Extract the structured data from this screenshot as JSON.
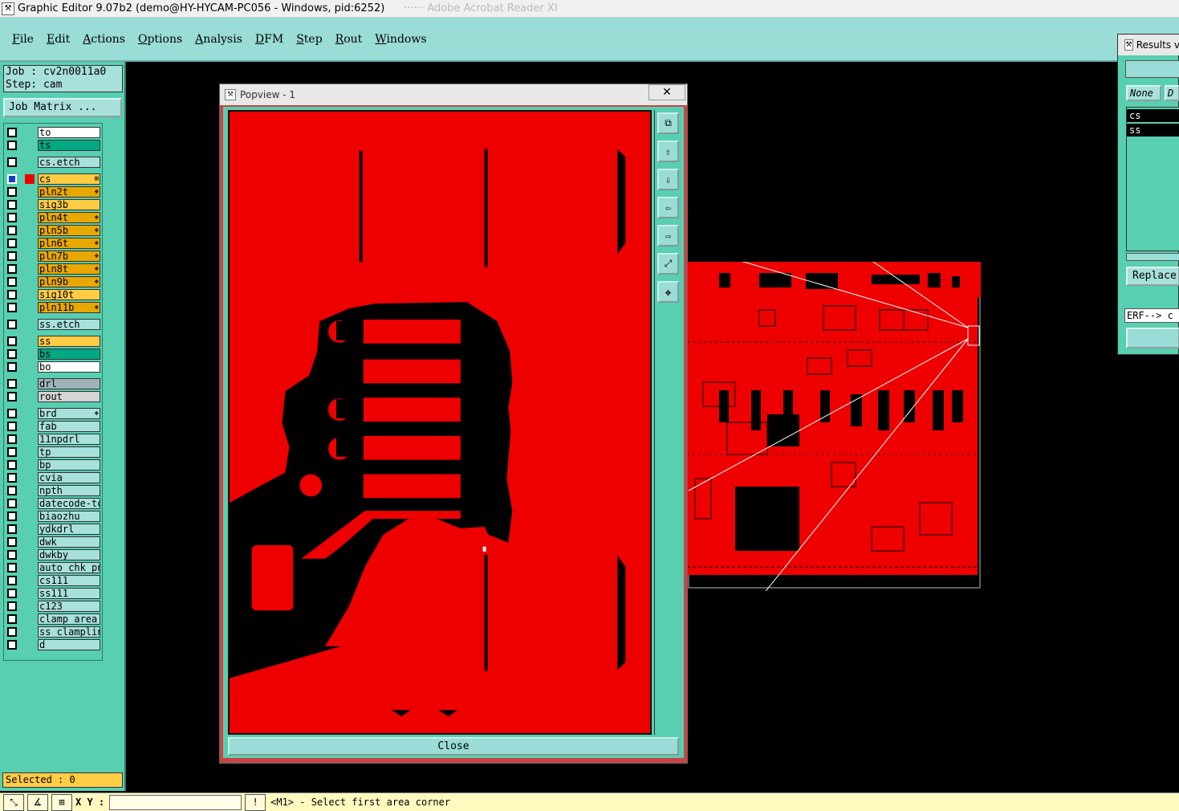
{
  "window": {
    "title": "Graphic Editor 9.07b2 (demo@HY-HYCAM-PC056 - Windows, pid:6252)",
    "ghost_text": "······  Adobe Acrobat Reader XI"
  },
  "menubar": [
    "File",
    "Edit",
    "Actions",
    "Options",
    "Analysis",
    "DFM",
    "Step",
    "Rout",
    "Windows"
  ],
  "job": {
    "job_line": "Job : cv2n0011a0",
    "step_line": "Step: cam",
    "matrix_button": "Job Matrix ..."
  },
  "layers": [
    {
      "name": "to",
      "color": "#ffffff"
    },
    {
      "name": "ts",
      "color": "#00a884"
    },
    {
      "name": "cs.etch",
      "color": "#a8e0dc"
    },
    {
      "name": "cs",
      "color": "#ffcc44",
      "active": true,
      "flag": "⊞"
    },
    {
      "name": "pln2t",
      "color": "#e8a800",
      "flag": "❖"
    },
    {
      "name": "sig3b",
      "color": "#ffcc44"
    },
    {
      "name": "pln4t",
      "color": "#e8a800",
      "flag": "❖"
    },
    {
      "name": "pln5b",
      "color": "#e8a800",
      "flag": "❖"
    },
    {
      "name": "pln6t",
      "color": "#e8a800",
      "flag": "❖"
    },
    {
      "name": "pln7b",
      "color": "#e8a800",
      "flag": "❖"
    },
    {
      "name": "pln8t",
      "color": "#e8a800",
      "flag": "❖"
    },
    {
      "name": "pln9b",
      "color": "#e8a800",
      "flag": "❖"
    },
    {
      "name": "sig10t",
      "color": "#ffcc44"
    },
    {
      "name": "pln11b",
      "color": "#e8a800",
      "flag": "❖"
    },
    {
      "name": "ss.etch",
      "color": "#a8e0dc"
    },
    {
      "name": "ss",
      "color": "#ffcc44"
    },
    {
      "name": "bs",
      "color": "#00a884"
    },
    {
      "name": "bo",
      "color": "#ffffff"
    },
    {
      "name": "drl",
      "color": "#a0b4b8"
    },
    {
      "name": "rout",
      "color": "#d4d4d4"
    },
    {
      "name": "brd",
      "color": "#a8e0dc",
      "flag": "❖"
    },
    {
      "name": "fab",
      "color": "#a8e0dc"
    },
    {
      "name": "11npdrl",
      "color": "#a8e0dc"
    },
    {
      "name": "tp",
      "color": "#a8e0dc"
    },
    {
      "name": "bp",
      "color": "#a8e0dc"
    },
    {
      "name": "cvia",
      "color": "#a8e0dc"
    },
    {
      "name": "npth",
      "color": "#a8e0dc"
    },
    {
      "name": "datecode-to",
      "color": "#a8e0dc"
    },
    {
      "name": "biaozhu",
      "color": "#a8e0dc"
    },
    {
      "name": "ydkdrl",
      "color": "#a8e0dc"
    },
    {
      "name": "dwk",
      "color": "#a8e0dc"
    },
    {
      "name": "dwkby",
      "color": "#a8e0dc"
    },
    {
      "name": "auto_chk_pnl",
      "color": "#a8e0dc"
    },
    {
      "name": "cs111",
      "color": "#a8e0dc"
    },
    {
      "name": "ss111",
      "color": "#a8e0dc"
    },
    {
      "name": "c123",
      "color": "#a8e0dc"
    },
    {
      "name": "clamp_area",
      "color": "#a8e0dc"
    },
    {
      "name": "ss_clampline",
      "color": "#a8e0dc"
    },
    {
      "name": "d",
      "color": "#a8e0dc"
    }
  ],
  "selected_text": "Selected : 0",
  "popview": {
    "title": "Popview - 1",
    "close_x": "✕",
    "close_button": "Close",
    "tools": [
      "zoom-window-icon",
      "pan-up-icon",
      "pan-down-icon",
      "pan-left-icon",
      "pan-right-icon",
      "zoom-fit-icon",
      "zoom-home-icon"
    ]
  },
  "results": {
    "title": "Results v",
    "none_label": "None",
    "none2_label": "D",
    "items": [
      "cs",
      "ss"
    ],
    "replace_button": "Replace",
    "erf_text": "ERF--> c"
  },
  "status": {
    "xy_label": "X Y :",
    "excl": "!",
    "message": "<M1> - Select first area corner"
  },
  "colors": {
    "copper": "#ee0000",
    "panel": "#58cfb1",
    "menu": "#9adcd6",
    "status": "#fff9c0"
  }
}
